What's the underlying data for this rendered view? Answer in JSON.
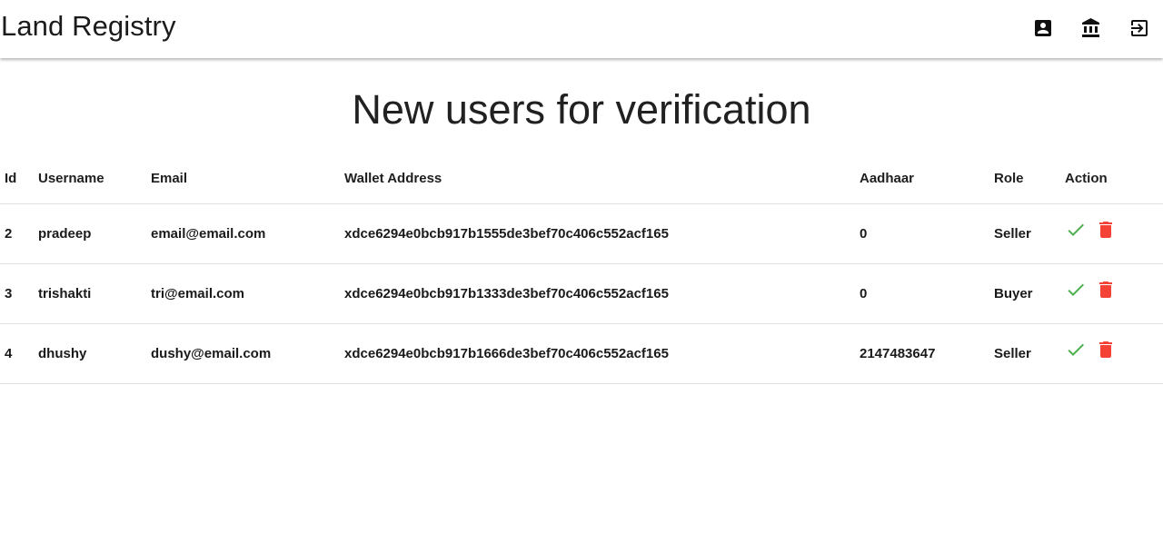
{
  "app": {
    "title": "Land Registry",
    "icons": [
      "account-box-icon",
      "bank-icon",
      "logout-icon"
    ]
  },
  "page": {
    "heading": "New users for verification"
  },
  "table": {
    "headers": [
      "Id",
      "Username",
      "Email",
      "Wallet Address",
      "Aadhaar",
      "Role",
      "Action"
    ],
    "rows": [
      {
        "id": "2",
        "username": "pradeep",
        "email": "email@email.com",
        "wallet": "xdce6294e0bcb917b1555de3bef70c406c552acf165",
        "aadhaar": "0",
        "role": "Seller"
      },
      {
        "id": "3",
        "username": "trishakti",
        "email": "tri@email.com",
        "wallet": "xdce6294e0bcb917b1333de3bef70c406c552acf165",
        "aadhaar": "0",
        "role": "Buyer"
      },
      {
        "id": "4",
        "username": "dhushy",
        "email": "dushy@email.com",
        "wallet": "xdce6294e0bcb917b1666de3bef70c406c552acf165",
        "aadhaar": "2147483647",
        "role": "Seller"
      }
    ],
    "action_icons": [
      "check-icon",
      "delete-icon"
    ]
  },
  "colors": {
    "approve": "#4caf50",
    "delete": "#f44336",
    "divider": "#e0e0e0"
  }
}
